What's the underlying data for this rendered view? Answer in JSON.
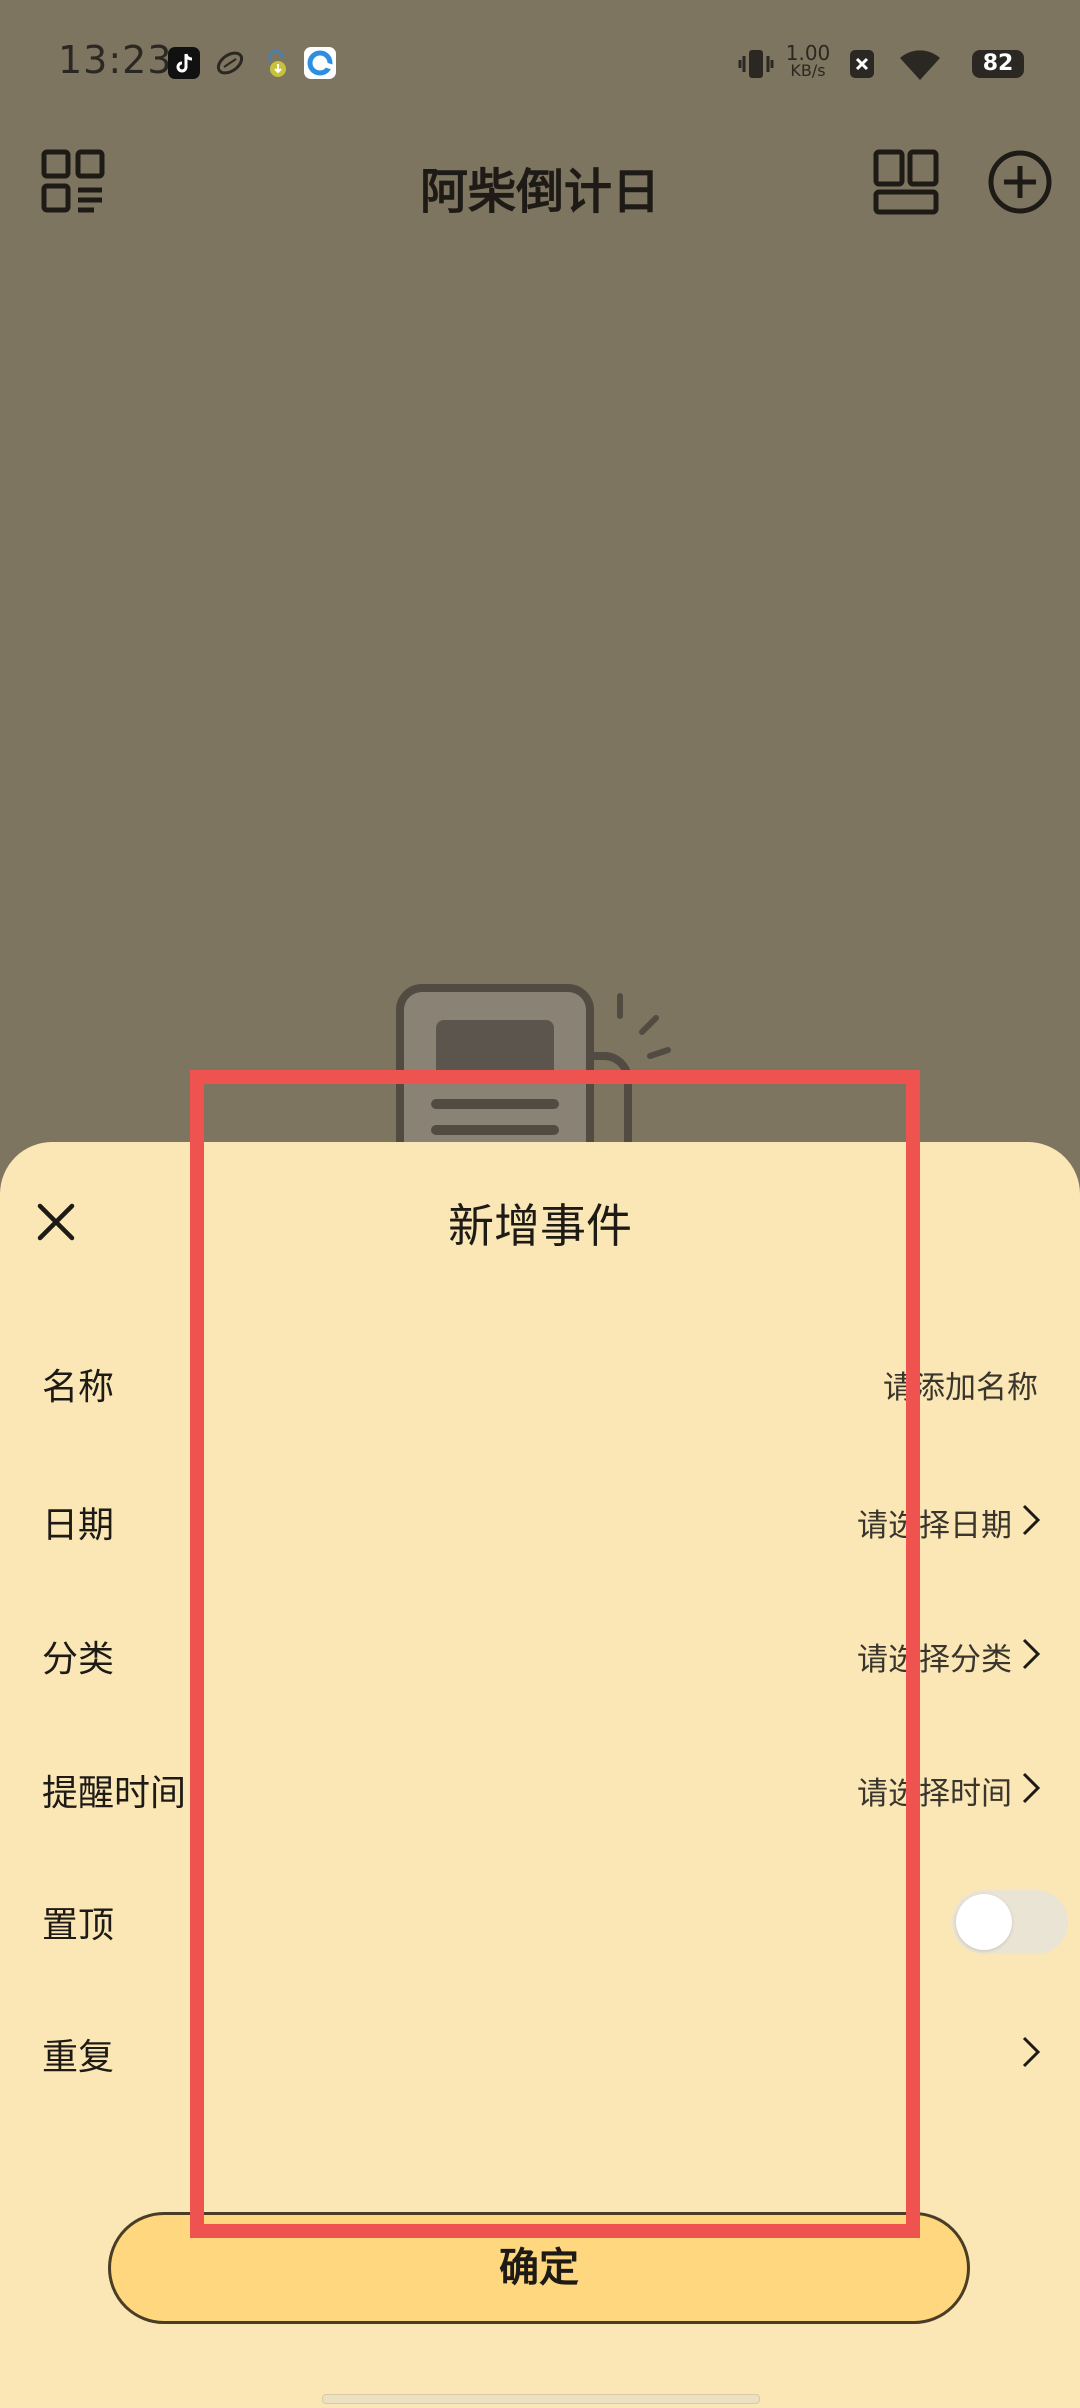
{
  "status_bar": {
    "time": "13:23",
    "net_speed_value": "1.00",
    "net_speed_unit": "KB/s",
    "battery": "82",
    "app_icons": [
      "tiktok-icon",
      "rugby-ball-icon",
      "download-lock-icon",
      "browser-icon"
    ]
  },
  "header": {
    "title": "阿柴倒计日",
    "left_icon": "grid-list-icon",
    "layout_icon": "layout-icon",
    "add_icon": "add-circle-icon"
  },
  "sheet": {
    "title": "新增事件",
    "close_icon": "close-icon",
    "rows": [
      {
        "label": "名称",
        "value": "请添加名称"
      },
      {
        "label": "日期",
        "value": "请选择日期"
      },
      {
        "label": "分类",
        "value": "请选择分类"
      },
      {
        "label": "提醒时间",
        "value": "请选择时间"
      },
      {
        "label": "置顶",
        "toggle_on": false
      },
      {
        "label": "重复",
        "value": ""
      }
    ],
    "confirm_label": "确定"
  },
  "colors": {
    "overlay_background": "#7e7560",
    "sheet_background": "#fae7b5",
    "confirm_button": "#fed77e",
    "highlight": "#ef5350"
  }
}
